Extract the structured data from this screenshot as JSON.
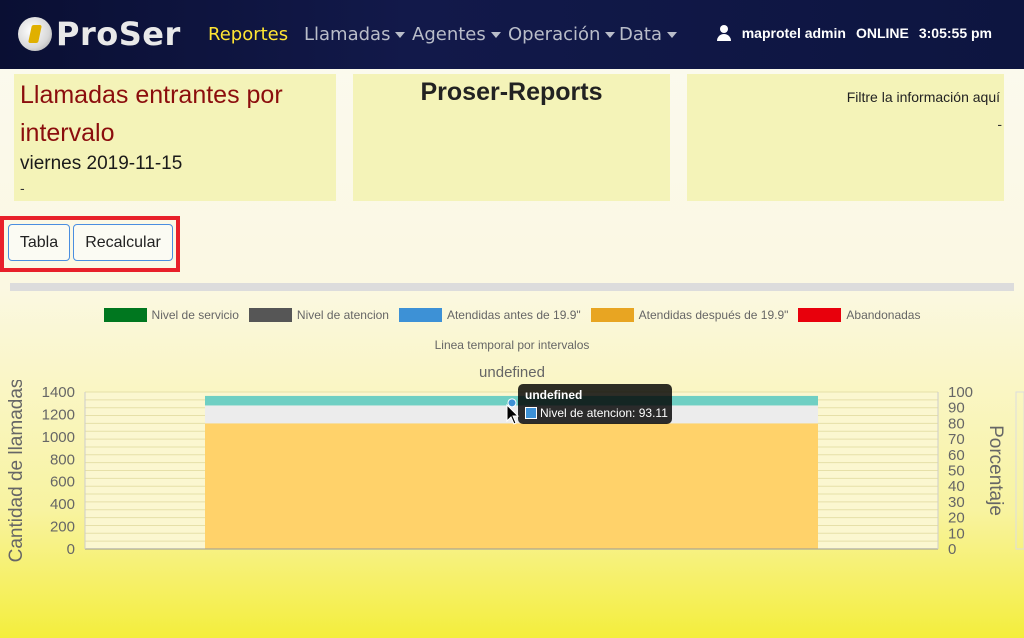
{
  "navbar": {
    "brand": "ProSer",
    "items": [
      {
        "label": "Reportes",
        "active": true,
        "dropdown": false
      },
      {
        "label": "Llamadas",
        "active": false,
        "dropdown": true
      },
      {
        "label": "Agentes",
        "active": false,
        "dropdown": true
      },
      {
        "label": "Operación",
        "active": false,
        "dropdown": true
      },
      {
        "label": "Data",
        "active": false,
        "dropdown": true
      }
    ],
    "user": "maprotel admin",
    "status": "ONLINE",
    "time": "3:05:55 pm"
  },
  "header": {
    "report_title": "Llamadas entrantes por intervalo",
    "report_date": "viernes 2019-11-15",
    "left_dash": "-",
    "center_title": "Proser-Reports",
    "filter_text": "Filtre la información aquí",
    "right_dash": "-"
  },
  "buttons": {
    "tabla": "Tabla",
    "recalcular": "Recalcular"
  },
  "chart_data": {
    "type": "bar",
    "subtitle": "Linea temporal por intervalos",
    "title": "undefined",
    "ylabel_left": "Cantidad de llamadas",
    "ylabel_right": "Porcentaje",
    "yticks_left": [
      "0",
      "200",
      "400",
      "600",
      "800",
      "1000",
      "1200",
      "1400"
    ],
    "yticks_right": [
      "0",
      "10",
      "20",
      "30",
      "40",
      "50",
      "60",
      "70",
      "80",
      "90",
      "100"
    ],
    "ylim_left": [
      0,
      1400
    ],
    "ylim_right": [
      0,
      100
    ],
    "legend": [
      {
        "name": "Nivel de servicio",
        "color": "#00771f"
      },
      {
        "name": "Nivel de atencion",
        "color": "#565656"
      },
      {
        "name": "Atendidas antes de 19.9\"",
        "color": "#3d91d6"
      },
      {
        "name": "Atendidas después de  19.9\"",
        "color": "#e8a522"
      },
      {
        "name": "Abandonadas",
        "color": "#e8000c"
      }
    ],
    "stacked_values": [
      {
        "series": "Atendidas después de  19.9\"",
        "value": 1120
      },
      {
        "series": "Abandonadas",
        "value": 160
      },
      {
        "series": "Atendidas antes de 19.9\"",
        "value": 85
      }
    ],
    "tooltip": {
      "title": "undefined",
      "label": "Nivel de atencion: 93.11"
    }
  }
}
